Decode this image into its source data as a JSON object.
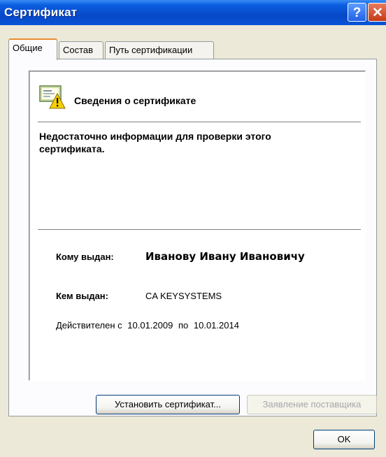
{
  "window": {
    "title": "Сертификат"
  },
  "tabs": [
    {
      "label": "Общие"
    },
    {
      "label": "Состав"
    },
    {
      "label": "Путь сертификации"
    }
  ],
  "info": {
    "header": "Сведения о сертификате",
    "warning": "Недостаточно информации для проверки этого сертификата.",
    "issued_to_label": "Кому выдан:",
    "issued_to": "Иванову Ивану Ивановичу",
    "issued_by_label": "Кем выдан:",
    "issued_by": "CA KEYSYSTEMS",
    "valid_from_label": "Действителен с",
    "valid_from": "10.01.2009",
    "valid_to_label": "по",
    "valid_to": "10.01.2014"
  },
  "buttons": {
    "install": "Установить сертификат...",
    "issuer_statement": "Заявление поставщика",
    "ok": "OK"
  },
  "icons": [
    "help-icon",
    "close-icon",
    "certificate-warning-icon"
  ],
  "colors": {
    "titlebar": "#0648c8",
    "tab_accent": "#e68b2c",
    "dialog_bg": "#ece9d8"
  }
}
